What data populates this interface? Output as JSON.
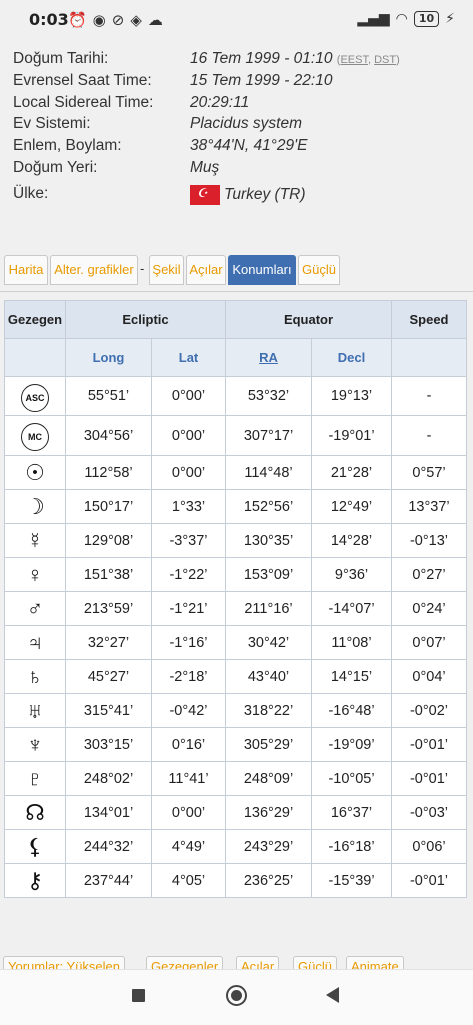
{
  "status": {
    "time": "0:03",
    "battery": "10"
  },
  "info": [
    {
      "label": "Doğum Tarihi:",
      "value": "16 Tem 1999 - 01:10",
      "tz1": "EEST",
      "tz2": "DST"
    },
    {
      "label": "Evrensel Saat Time:",
      "value": "15 Tem 1999 - 22:10"
    },
    {
      "label": "Local Sidereal Time:",
      "value": "20:29:11"
    },
    {
      "label": "Ev Sistemi:",
      "value": "Placidus system"
    },
    {
      "label": "Enlem, Boylam:",
      "value": "38°44'N, 41°29'E"
    },
    {
      "label": "Doğum Yeri:",
      "value": "Muş"
    },
    {
      "label": "Ülke:",
      "value": "Turkey (TR)"
    }
  ],
  "tabs": [
    "Harita",
    "Alter. grafikler",
    "-",
    "Şekil",
    "Açılar",
    "Konumları",
    "Güçlü"
  ],
  "table": {
    "headers": {
      "planet": "Gezegen",
      "ecliptic": "Ecliptic",
      "equator": "Equator",
      "speed": "Speed"
    },
    "subheaders": {
      "long": "Long",
      "lat": "Lat",
      "ra": "RA",
      "decl": "Decl"
    },
    "rows": [
      {
        "glyph": "ASC",
        "long": "55°51’",
        "lat": "0°00’",
        "ra": "53°32’",
        "decl": "19°13’",
        "speed": "-"
      },
      {
        "glyph": "MC",
        "long": "304°56’",
        "lat": "0°00’",
        "ra": "307°17’",
        "decl": "-19°01’",
        "speed": "-"
      },
      {
        "glyph": "☉",
        "long": "112°58’",
        "lat": "0°00’",
        "ra": "114°48’",
        "decl": "21°28’",
        "speed": "0°57’"
      },
      {
        "glyph": "☽",
        "long": "150°17’",
        "lat": "1°33’",
        "ra": "152°56’",
        "decl": "12°49’",
        "speed": "13°37’"
      },
      {
        "glyph": "☿",
        "long": "129°08’",
        "lat": "-3°37’",
        "ra": "130°35’",
        "decl": "14°28’",
        "speed": "-0°13’"
      },
      {
        "glyph": "♀",
        "long": "151°38’",
        "lat": "-1°22’",
        "ra": "153°09’",
        "decl": "9°36’",
        "speed": "0°27’"
      },
      {
        "glyph": "♂",
        "long": "213°59’",
        "lat": "-1°21’",
        "ra": "211°16’",
        "decl": "-14°07’",
        "speed": "0°24’"
      },
      {
        "glyph": "♃",
        "long": "32°27’",
        "lat": "-1°16’",
        "ra": "30°42’",
        "decl": "11°08’",
        "speed": "0°07’"
      },
      {
        "glyph": "♄",
        "long": "45°27’",
        "lat": "-2°18’",
        "ra": "43°40’",
        "decl": "14°15’",
        "speed": "0°04’"
      },
      {
        "glyph": "♅",
        "long": "315°41’",
        "lat": "-0°42’",
        "ra": "318°22’",
        "decl": "-16°48’",
        "speed": "-0°02’"
      },
      {
        "glyph": "♆",
        "long": "303°15’",
        "lat": "0°16’",
        "ra": "305°29’",
        "decl": "-19°09’",
        "speed": "-0°01’"
      },
      {
        "glyph": "♇",
        "long": "248°02’",
        "lat": "11°41’",
        "ra": "248°09’",
        "decl": "-10°05’",
        "speed": "-0°01’"
      },
      {
        "glyph": "☊",
        "long": "134°01’",
        "lat": "0°00’",
        "ra": "136°29’",
        "decl": "16°37’",
        "speed": "-0°03’"
      },
      {
        "glyph": "⚸",
        "long": "244°32’",
        "lat": "4°49’",
        "ra": "243°29’",
        "decl": "-16°18’",
        "speed": "0°06’"
      },
      {
        "glyph": "⚷",
        "long": "237°44’",
        "lat": "4°05’",
        "ra": "236°25’",
        "decl": "-15°39’",
        "speed": "-0°01’"
      }
    ]
  },
  "bottom_buttons": [
    "Yorumlar: Yükselen",
    "Gezegenler",
    "Açılar",
    "Güçlü",
    "Animate"
  ]
}
